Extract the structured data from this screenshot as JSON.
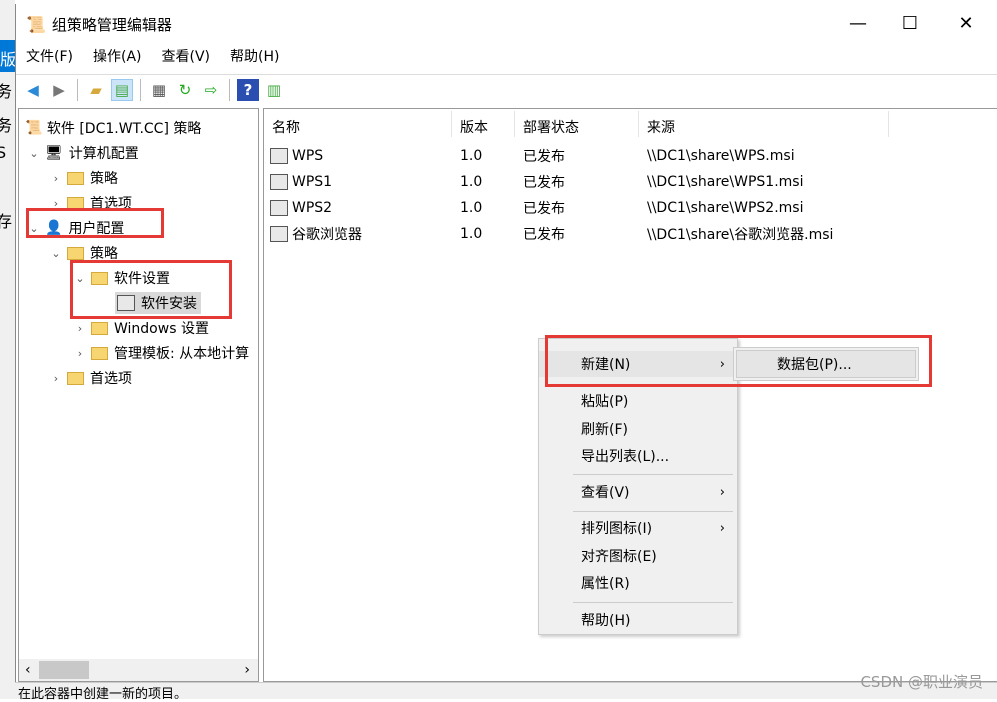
{
  "window": {
    "title": "组策略管理编辑器",
    "minimize": "—",
    "maximize": "☐",
    "close": "✕"
  },
  "menu": [
    "文件(F)",
    "操作(A)",
    "查看(V)",
    "帮助(H)"
  ],
  "toolbar": [
    "back-icon",
    "forward-icon",
    "up-folder-icon",
    "show-hide-tree-icon",
    "properties-icon",
    "refresh-icon",
    "export-list-icon",
    "help-icon",
    "show-action-pane-icon"
  ],
  "tree": {
    "root": "软件 [DC1.WT.CC] 策略",
    "computer": "计算机配置",
    "c_policy": "策略",
    "c_pref": "首选项",
    "user": "用户配置",
    "u_policy": "策略",
    "sw_settings": "软件设置",
    "sw_install": "软件安装",
    "windows_settings": "Windows 设置",
    "admin_templates": "管理模板: 从本地计算",
    "u_pref": "首选项"
  },
  "list": {
    "columns": [
      "名称",
      "版本",
      "部署状态",
      "来源"
    ],
    "rows": [
      [
        "WPS",
        "1.0",
        "已发布",
        "\\\\DC1\\share\\WPS.msi"
      ],
      [
        "WPS1",
        "1.0",
        "已发布",
        "\\\\DC1\\share\\WPS1.msi"
      ],
      [
        "WPS2",
        "1.0",
        "已发布",
        "\\\\DC1\\share\\WPS2.msi"
      ],
      [
        "谷歌浏览器",
        "1.0",
        "已发布",
        "\\\\DC1\\share\\谷歌浏览器.msi"
      ]
    ]
  },
  "context_menu": {
    "new": "新建(N)",
    "paste": "粘贴(P)",
    "refresh": "刷新(F)",
    "export": "导出列表(L)...",
    "view": "查看(V)",
    "arrange": "排列图标(I)",
    "align": "对齐图标(E)",
    "properties": "属性(R)",
    "help": "帮助(H)"
  },
  "submenu": {
    "package": "数据包(P)..."
  },
  "status": "在此容器中创建一新的项目。",
  "watermark": "CSDN @职业演员",
  "background_fragments": [
    "版",
    "务",
    "务",
    "S",
    "存"
  ],
  "colors": {
    "highlight": "#e53935",
    "accent": "#0078d7"
  }
}
